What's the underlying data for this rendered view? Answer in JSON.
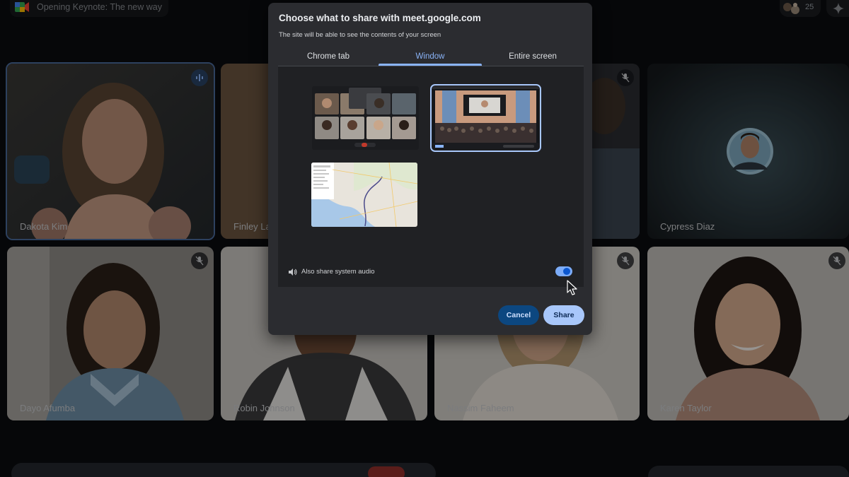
{
  "meeting": {
    "title": "Opening Keynote: The new way",
    "participant_count": "25"
  },
  "participants": [
    {
      "name": "Dakota Kim",
      "speaking": true
    },
    {
      "name": "Finley La"
    },
    {
      "name": ""
    },
    {
      "name": "Cypress Diaz"
    },
    {
      "name": "Dayo Afumba"
    },
    {
      "name": "Robin Johnson"
    },
    {
      "name": "Nassim Faheem"
    },
    {
      "name": "Karen Taylor"
    }
  ],
  "dialog": {
    "title": "Choose what to share with meet.google.com",
    "subtitle": "The site will be able to see the contents of your screen",
    "tabs": [
      {
        "label": "Chrome tab",
        "active": false
      },
      {
        "label": "Window",
        "active": true
      },
      {
        "label": "Entire screen",
        "active": false
      }
    ],
    "windows": [
      {
        "kind": "meet-grid-window",
        "selected": false
      },
      {
        "kind": "keynote-presentation-window",
        "selected": true
      },
      {
        "kind": "maps-window",
        "selected": false
      }
    ],
    "audio_label": "Also share system audio",
    "audio_enabled": true,
    "cancel_label": "Cancel",
    "share_label": "Share"
  },
  "colors": {
    "accent": "#8ab4f8",
    "dialog_bg": "#2b2c30",
    "panel_bg": "#202124",
    "share_button": "#a8c7fa",
    "cancel_button": "#0c4780"
  },
  "icons": [
    "meet-logo-icon",
    "people-icon",
    "gemini-sparkle-icon",
    "mic-off-icon",
    "speaking-icon",
    "speaker-icon",
    "mouse-pointer-icon"
  ]
}
